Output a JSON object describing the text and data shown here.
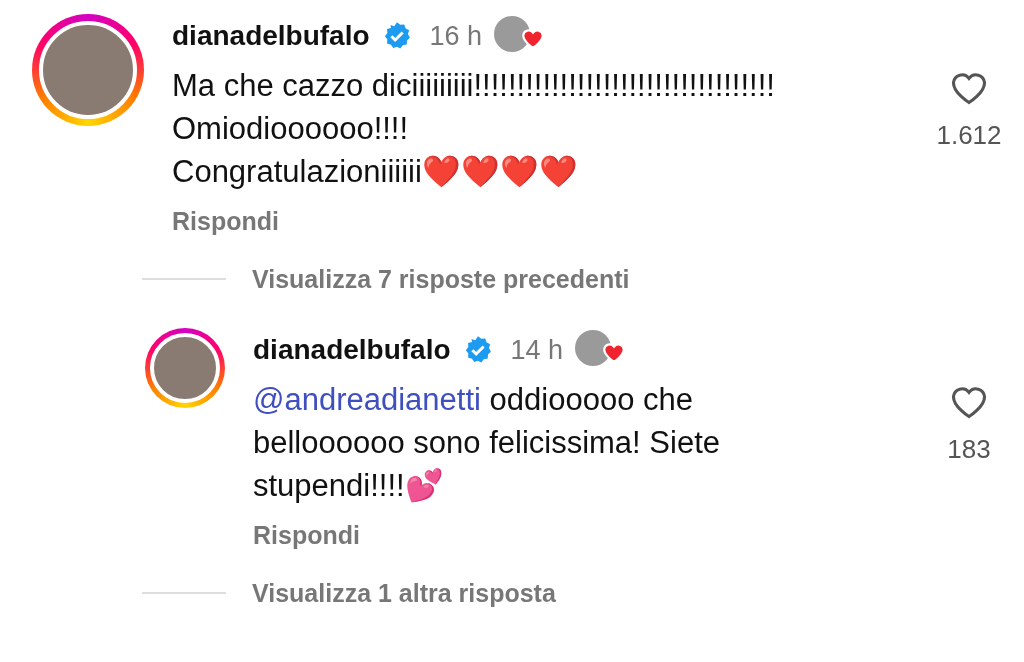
{
  "comments": [
    {
      "kind": "comment",
      "username": "dianadelbufalo",
      "verified": true,
      "time": "16 h",
      "liked_by_author": true,
      "text": "Ma che cazzo diciiiiiiiii!!!!!!!!!!!!!!!!!!!!!!!!!!!!!!!!!!!\nOmiodioooooo!!!!\nCongratulazioniiiiii❤️❤️❤️❤️",
      "likes": "1.612",
      "reply_label": "Rispondi",
      "replies_link": "Visualizza 7 risposte precedenti"
    },
    {
      "kind": "reply",
      "username": "dianadelbufalo",
      "verified": true,
      "time": "14 h",
      "liked_by_author": true,
      "mention": "@andreadianetti",
      "text": " oddiooooo che belloooooo sono felicissima! Siete stupendi!!!!💕",
      "likes": "183",
      "reply_label": "Rispondi",
      "replies_link": "Visualizza 1 altra risposta"
    }
  ]
}
